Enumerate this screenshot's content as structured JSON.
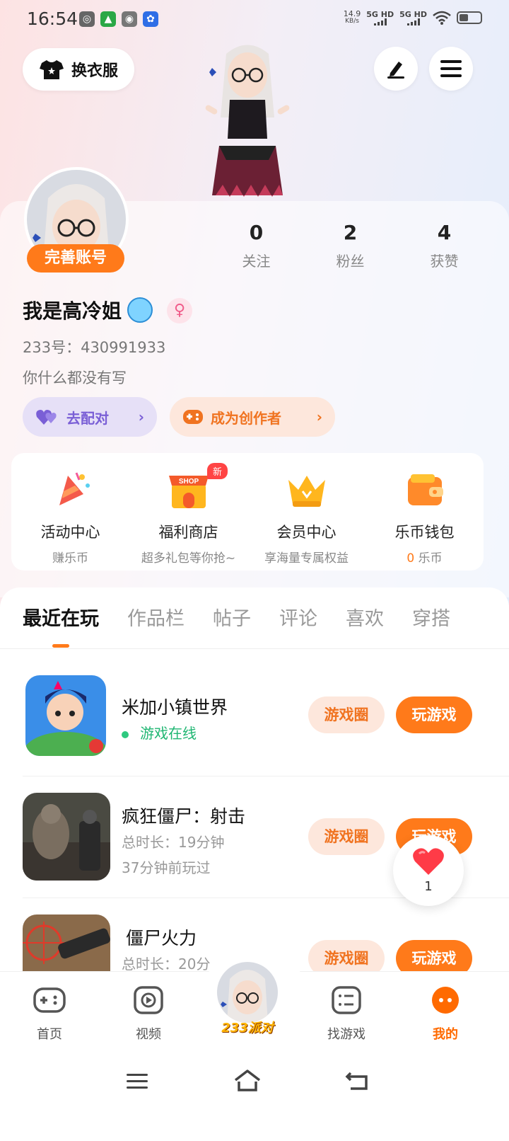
{
  "status_bar": {
    "time": "16:54",
    "net_speed_value": "14.9",
    "net_speed_unit": "KB/s",
    "sim1": "5G HD",
    "sim2": "5G HD"
  },
  "header": {
    "outfit_label": "换衣服",
    "icons": [
      "tshirt-icon",
      "edit-icon",
      "menu-icon"
    ]
  },
  "profile": {
    "improve_account": "完善账号",
    "stats": [
      {
        "value": "0",
        "label": "关注"
      },
      {
        "value": "2",
        "label": "粉丝"
      },
      {
        "value": "4",
        "label": "获赞"
      }
    ],
    "nickname": "我是高冷姐",
    "gender_symbol": "♀",
    "uid": "233号：430991933",
    "bio": "你什么都没有写",
    "match_label": "去配对",
    "creator_label": "成为创作者"
  },
  "features": [
    {
      "title": "活动中心",
      "sub": "赚乐币",
      "icon": "party-popper-icon"
    },
    {
      "title": "福利商店",
      "sub": "超多礼包等你抢~",
      "icon": "shop-icon",
      "badge": "新"
    },
    {
      "title": "会员中心",
      "sub": "享海量专属权益",
      "icon": "crown-icon"
    },
    {
      "title": "乐币钱包",
      "sub_coin": "0",
      "sub_unit": " 乐币",
      "icon": "wallet-icon"
    }
  ],
  "tabs": [
    "最近在玩",
    "作品栏",
    "帖子",
    "评论",
    "喜欢",
    "穿搭"
  ],
  "games": [
    {
      "name": "米加小镇世界",
      "status": "游戏在线",
      "circle_label": "游戏圈",
      "play_label": "玩游戏"
    },
    {
      "name": "疯狂僵尸：射击",
      "duration": "总时长：19分钟",
      "last_played": "37分钟前玩过",
      "circle_label": "游戏圈",
      "play_label": "玩游戏"
    },
    {
      "name": "僵尸火力",
      "duration": "总时长：20分",
      "circle_label": "游戏圈",
      "play_label": "玩游戏"
    }
  ],
  "like_float": {
    "count": "1"
  },
  "bottom_nav": [
    {
      "label": "首页",
      "icon": "gamepad-icon"
    },
    {
      "label": "视频",
      "icon": "play-icon"
    },
    {
      "label": "233派对",
      "icon": "avatar"
    },
    {
      "label": "找游戏",
      "icon": "list-icon"
    },
    {
      "label": "我的",
      "icon": "profile-face-icon"
    }
  ],
  "colors": {
    "accent": "#ff7a1a",
    "purple": "#7a5fd6",
    "online": "#1fb672"
  }
}
